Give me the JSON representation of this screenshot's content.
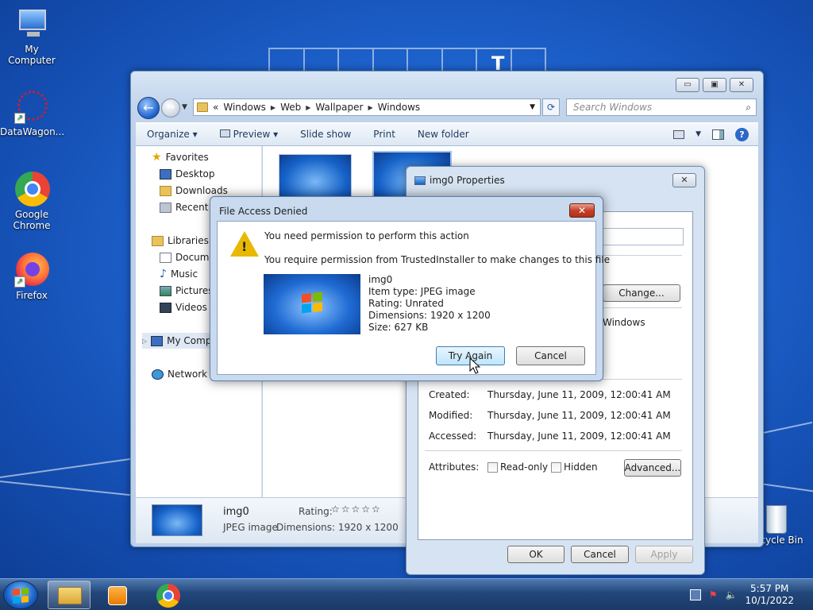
{
  "desktop": {
    "icons": [
      {
        "label": "My Computer"
      },
      {
        "label": "DataWagon..."
      },
      {
        "label": "Google Chrome"
      },
      {
        "label": "Firefox"
      },
      {
        "label": "Recycle Bin"
      }
    ],
    "grid_letter": "T"
  },
  "explorer": {
    "caption": {
      "minimize": "▭",
      "maximize": "▣",
      "close": "✕"
    },
    "back": "←",
    "forward": "→",
    "address": {
      "prefix": "«",
      "crumbs": [
        "Windows",
        "Web",
        "Wallpaper",
        "Windows"
      ]
    },
    "refresh": "⟳",
    "search": {
      "placeholder": "Search Windows",
      "icon": "⌕"
    },
    "toolbar": {
      "organize": "Organize ▾",
      "preview": "Preview ▾",
      "slideshow": "Slide show",
      "print": "Print",
      "new_folder": "New folder"
    },
    "nav": {
      "favorites": "Favorites",
      "desktop": "Desktop",
      "downloads": "Downloads",
      "recent": "Recent Places",
      "libraries": "Libraries",
      "documents": "Documents",
      "music": "Music",
      "pictures": "Pictures",
      "videos": "Videos",
      "computer": "My Computer",
      "network": "Network"
    },
    "details": {
      "name": "img0",
      "type": "JPEG image",
      "rating_label": "Rating:",
      "stars": "☆☆☆☆☆",
      "dimensions": "Dimensions: 1920 x 1200"
    }
  },
  "properties": {
    "title": "img0 Properties",
    "change_button": "Change...",
    "opens_with_fragment": "Windows",
    "dates": [
      {
        "label": "Created:",
        "value": "Thursday, June 11, 2009, 12:00:41 AM"
      },
      {
        "label": "Modified:",
        "value": "Thursday, June 11, 2009, 12:00:41 AM"
      },
      {
        "label": "Accessed:",
        "value": "Thursday, June 11, 2009, 12:00:41 AM"
      }
    ],
    "attributes_label": "Attributes:",
    "readonly": "Read-only",
    "hidden": "Hidden",
    "advanced": "Advanced...",
    "ok": "OK",
    "cancel": "Cancel",
    "apply": "Apply"
  },
  "dialog": {
    "title": "File Access Denied",
    "message": "You need permission to perform this action",
    "detail": "You require permission from TrustedInstaller to make changes to this file",
    "file": {
      "name": "img0",
      "item_type": "Item type: JPEG image",
      "rating": "Rating: Unrated",
      "dimensions": "Dimensions: 1920 x 1200",
      "size": "Size: 627 KB"
    },
    "try_again": "Try Again",
    "cancel": "Cancel"
  },
  "taskbar": {
    "time": "5:57 PM",
    "date": "10/1/2022"
  }
}
